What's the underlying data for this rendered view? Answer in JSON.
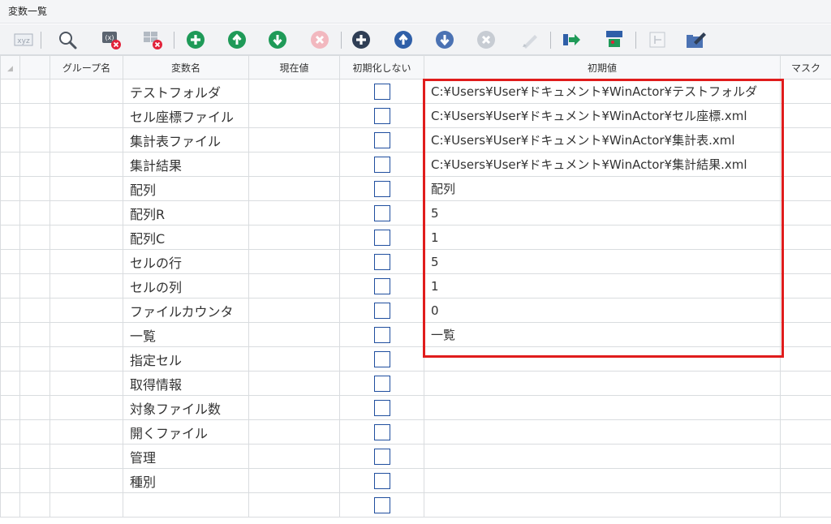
{
  "panel": {
    "title": "変数一覧"
  },
  "toolbar": {
    "buttons": [
      {
        "name": "xyz-button",
        "icon": "xyz-icon"
      },
      {
        "name": "search-button",
        "icon": "magnifier-icon"
      },
      {
        "name": "delete-unused-button",
        "icon": "delete-unused-variable-icon"
      },
      {
        "name": "delete-all-button",
        "icon": "delete-all-variable-icon"
      },
      {
        "name": "add-variable-button",
        "icon": "plus-circle-icon"
      },
      {
        "name": "move-up-button",
        "icon": "arrow-up-circle-icon"
      },
      {
        "name": "move-down-button",
        "icon": "arrow-down-circle-icon"
      },
      {
        "name": "delete-variable-button",
        "icon": "x-circle-icon"
      },
      {
        "name": "add-group-button",
        "icon": "plus-circle-dark-icon"
      },
      {
        "name": "group-up-button",
        "icon": "arrow-up-circle-dark-icon"
      },
      {
        "name": "group-down-button",
        "icon": "arrow-down-circle-dark-icon"
      },
      {
        "name": "delete-group-button",
        "icon": "x-circle-gray-icon"
      },
      {
        "name": "edit-button",
        "icon": "pen-icon"
      },
      {
        "name": "import-button",
        "icon": "import-arrow-icon"
      },
      {
        "name": "tree-button",
        "icon": "tree-icon"
      },
      {
        "name": "collapse-button",
        "icon": "collapse-icon"
      },
      {
        "name": "export-button",
        "icon": "folder-pen-icon"
      }
    ]
  },
  "table": {
    "headers": {
      "group": "グループ名",
      "name": "変数名",
      "current": "現在値",
      "no_init": "初期化しない",
      "initial": "初期値",
      "mask": "マスク"
    },
    "rows": [
      {
        "name": "テストフォルダ",
        "initial": "C:¥Users¥User¥ドキュメント¥WinActor¥テストフォルダ"
      },
      {
        "name": "セル座標ファイル",
        "initial": "C:¥Users¥User¥ドキュメント¥WinActor¥セル座標.xml"
      },
      {
        "name": "集計表ファイル",
        "initial": "C:¥Users¥User¥ドキュメント¥WinActor¥集計表.xml"
      },
      {
        "name": "集計結果",
        "initial": "C:¥Users¥User¥ドキュメント¥WinActor¥集計結果.xml"
      },
      {
        "name": "配列",
        "initial": "配列"
      },
      {
        "name": "配列R",
        "initial": "5"
      },
      {
        "name": "配列C",
        "initial": "1"
      },
      {
        "name": "セルの行",
        "initial": "5"
      },
      {
        "name": "セルの列",
        "initial": "1"
      },
      {
        "name": "ファイルカウンタ",
        "initial": "0"
      },
      {
        "name": "一覧",
        "initial": "一覧"
      },
      {
        "name": "指定セル",
        "initial": ""
      },
      {
        "name": "取得情報",
        "initial": ""
      },
      {
        "name": "対象ファイル数",
        "initial": ""
      },
      {
        "name": "開くファイル",
        "initial": ""
      },
      {
        "name": "管理",
        "initial": ""
      },
      {
        "name": "種別",
        "initial": ""
      },
      {
        "name": "",
        "initial": ""
      }
    ]
  },
  "colors": {
    "highlight": "#e01c1c",
    "checkbox_border": "#1f4e9e",
    "green_button": "#1f9a58",
    "blue_button": "#2f5fa8"
  }
}
